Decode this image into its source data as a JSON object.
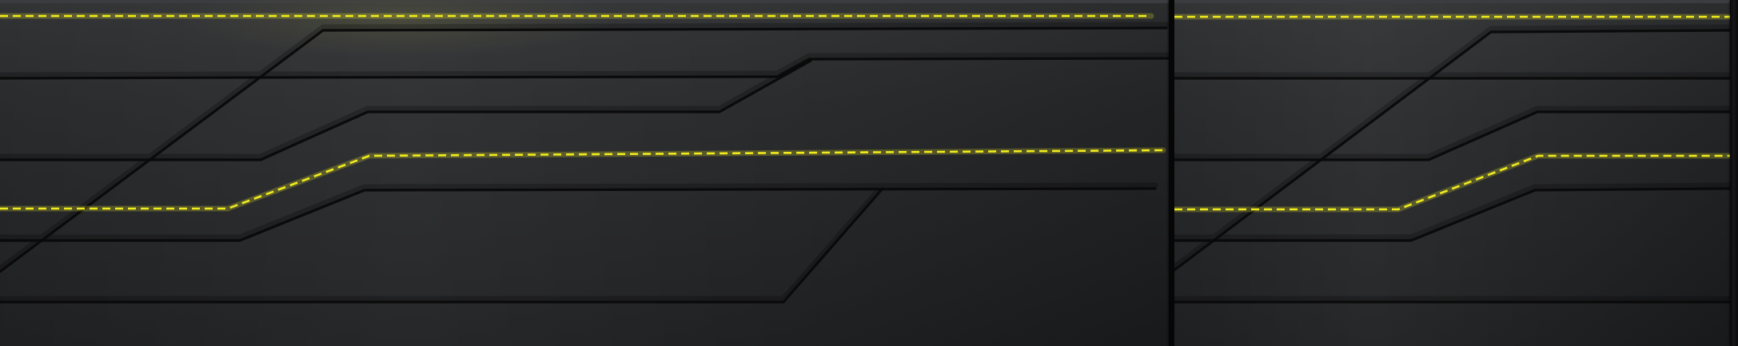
{
  "scene": {
    "colors": {
      "background": "#1b1c1e",
      "track": "#09090a",
      "highlighted_route": "#f1ec1e",
      "divider": "#060607"
    },
    "elements": {
      "left_panel": "track-panel",
      "right_panel": "track-panel",
      "highlighted_routes": "dashed-yellow-path",
      "track_lines": "black-path"
    }
  }
}
